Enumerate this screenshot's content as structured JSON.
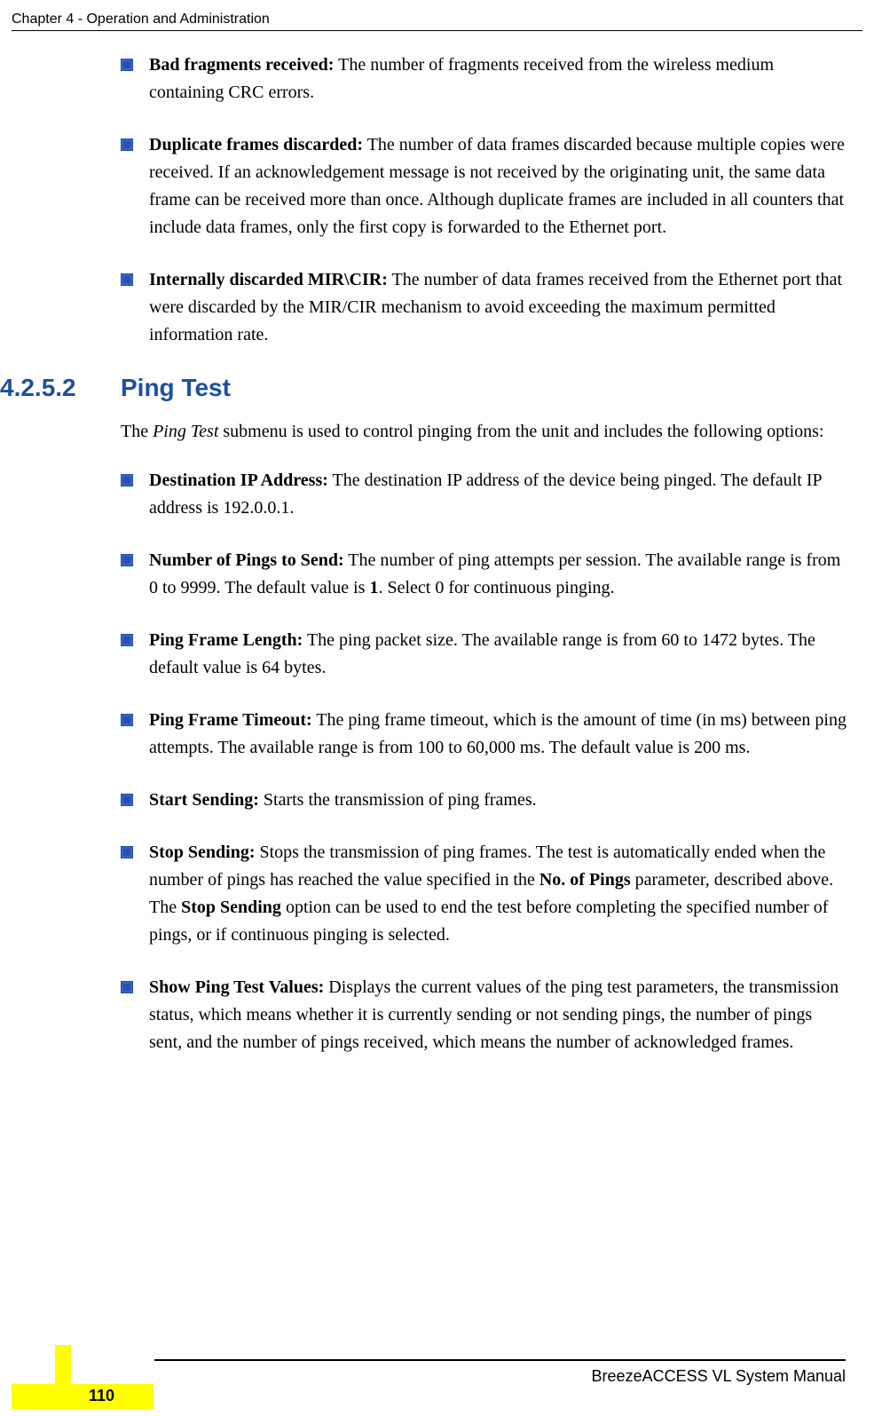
{
  "header": "Chapter 4 - Operation and Administration",
  "bullets_top": [
    {
      "term": "Bad fragments received:",
      "body": " The number of fragments received from the wireless medium containing CRC errors."
    },
    {
      "term": "Duplicate frames discarded:",
      "body": " The number of data frames discarded because multiple copies were received. If an acknowledgement message is not received by the originating unit, the same data frame can be received more than once. Although duplicate frames are included in all counters that include data frames, only the first copy is forwarded to the Ethernet port."
    },
    {
      "term": "Internally discarded MIR\\CIR:",
      "body": " The number of data frames received from the Ethernet port that were discarded by the MIR/CIR mechanism to avoid exceeding the maximum permitted information rate."
    }
  ],
  "section": {
    "num": "4.2.5.2",
    "title": "Ping Test"
  },
  "intro_pre": "The ",
  "intro_italic": "Ping Test",
  "intro_post": " submenu is used to control pinging from the unit and includes the following options:",
  "bullets_ping": [
    {
      "term": "Destination IP Address:",
      "body": " The destination IP address of the device being pinged. The default IP address is 192.0.0.1."
    },
    {
      "term": "Number of Pings to Send:",
      "body_pre": " The number of ping attempts per session. The available range is from 0 to 9999. The default value is ",
      "bold_inline": "1",
      "body_post": ". Select 0 for continuous pinging."
    },
    {
      "term": "Ping Frame Length:",
      "body": " The ping packet size. The available range is from 60 to 1472 bytes. The default value is 64 bytes."
    },
    {
      "term": "Ping Frame Timeout:",
      "body": " The ping frame timeout, which is the amount of time (in ms) between ping attempts. The available range is from 100 to 60,000 ms. The default value is 200 ms."
    },
    {
      "term": "Start Sending:",
      "body": " Starts the transmission of ping frames."
    },
    {
      "term": "Stop Sending:",
      "body_pre": " Stops the transmission of ping frames. The test is automatically ended when the number of pings has reached the value specified in the ",
      "bold_inline": "No. of Pings",
      "body_mid": " parameter, described above. The ",
      "bold_inline2": "Stop Sending",
      "body_post": " option can be used to end the test before completing the specified number of pings, or if continuous pinging is selected."
    },
    {
      "term": "Show Ping Test Values:",
      "body": " Displays the current values of the ping test parameters, the transmission status, which means whether it is currently sending or not sending pings, the number of pings sent, and the number of pings received, which means the number of acknowledged frames."
    }
  ],
  "footer": {
    "manual": "BreezeACCESS VL System Manual",
    "page": "110"
  }
}
